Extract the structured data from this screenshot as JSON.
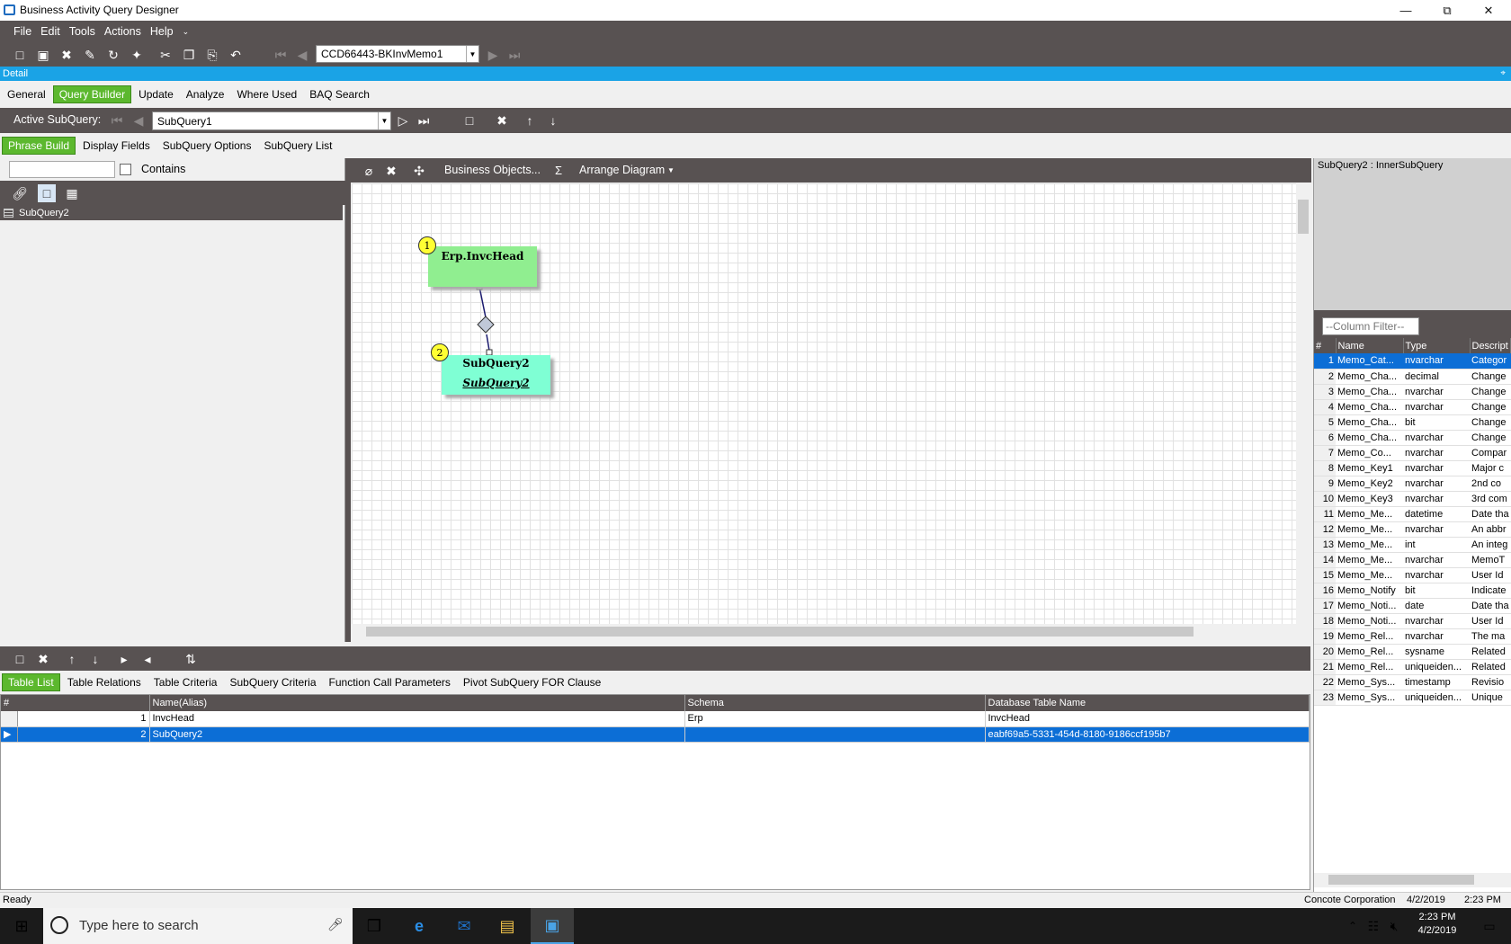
{
  "window": {
    "title": "Business Activity Query Designer",
    "minimize_icon": "minimize-icon",
    "restore_icon": "restore-icon",
    "close_icon": "close-icon"
  },
  "menu": [
    "File",
    "Edit",
    "Tools",
    "Actions",
    "Help"
  ],
  "toolbar": {
    "record_value": "CCD66443-BKInvMemo1",
    "icons": [
      "new-icon",
      "save-icon",
      "delete-icon",
      "edit-icon",
      "refresh-icon",
      "clear-icon",
      "cut-icon",
      "copy-icon",
      "paste-icon",
      "undo-icon",
      "first-icon",
      "prev-icon",
      "next-icon",
      "last-icon"
    ]
  },
  "detail_label": "Detail",
  "main_tabs": [
    "General",
    "Query Builder",
    "Update",
    "Analyze",
    "Where Used",
    "BAQ Search"
  ],
  "subquery_bar": {
    "label": "Active SubQuery:",
    "value": "SubQuery1"
  },
  "sub_tabs": [
    "Phrase Build",
    "Display Fields",
    "SubQuery Options",
    "SubQuery List"
  ],
  "left_panel": {
    "search_value": "",
    "contains_label": "Contains",
    "tree_item": "SubQuery2"
  },
  "diagram_toolbar": {
    "business_objects": "Business Objects...",
    "sigma": "Σ",
    "arrange": "Arrange Diagram"
  },
  "diagram": {
    "nodes": [
      {
        "badge": "1",
        "title": "Erp.InvcHead",
        "subtitle": "",
        "color": "#90ee90"
      },
      {
        "badge": "2",
        "title": "SubQuery2",
        "subtitle": "SubQuery2",
        "color": "#7fffd4"
      }
    ]
  },
  "right_panel": {
    "header": "SubQuery2 : InnerSubQuery",
    "filter_placeholder": "--Column Filter--",
    "columns": [
      "#",
      "Name",
      "Type",
      "Descript"
    ],
    "rows": [
      [
        "1",
        "Memo_Cat...",
        "nvarchar",
        "Categor"
      ],
      [
        "2",
        "Memo_Cha...",
        "decimal",
        "Change"
      ],
      [
        "3",
        "Memo_Cha...",
        "nvarchar",
        "Change"
      ],
      [
        "4",
        "Memo_Cha...",
        "nvarchar",
        "Change"
      ],
      [
        "5",
        "Memo_Cha...",
        "bit",
        "Change"
      ],
      [
        "6",
        "Memo_Cha...",
        "nvarchar",
        "Change"
      ],
      [
        "7",
        "Memo_Co...",
        "nvarchar",
        "Compar"
      ],
      [
        "8",
        "Memo_Key1",
        "nvarchar",
        "Major c"
      ],
      [
        "9",
        "Memo_Key2",
        "nvarchar",
        "2nd co"
      ],
      [
        "10",
        "Memo_Key3",
        "nvarchar",
        "3rd com"
      ],
      [
        "11",
        "Memo_Me...",
        "datetime",
        "Date tha"
      ],
      [
        "12",
        "Memo_Me...",
        "nvarchar",
        "An abbr"
      ],
      [
        "13",
        "Memo_Me...",
        "int",
        "An integ"
      ],
      [
        "14",
        "Memo_Me...",
        "nvarchar",
        "MemoT"
      ],
      [
        "15",
        "Memo_Me...",
        "nvarchar",
        "User Id"
      ],
      [
        "16",
        "Memo_Notify",
        "bit",
        "Indicate"
      ],
      [
        "17",
        "Memo_Noti...",
        "date",
        "Date tha"
      ],
      [
        "18",
        "Memo_Noti...",
        "nvarchar",
        "User Id"
      ],
      [
        "19",
        "Memo_Rel...",
        "nvarchar",
        "The ma"
      ],
      [
        "20",
        "Memo_Rel...",
        "sysname",
        "Related"
      ],
      [
        "21",
        "Memo_Rel...",
        "uniqueiden...",
        "Related"
      ],
      [
        "22",
        "Memo_Sys...",
        "timestamp",
        "Revisio"
      ],
      [
        "23",
        "Memo_Sys...",
        "uniqueiden...",
        "Unique"
      ]
    ]
  },
  "bottom_tabs": [
    "Table List",
    "Table Relations",
    "Table Criteria",
    "SubQuery Criteria",
    "Function Call Parameters",
    "Pivot SubQuery FOR Clause"
  ],
  "table_list": {
    "columns": [
      "#",
      "Name(Alias)",
      "Schema",
      "Database Table Name"
    ],
    "rows": [
      [
        "1",
        "InvcHead",
        "Erp",
        "InvcHead"
      ],
      [
        "2",
        "SubQuery2",
        "",
        "eabf69a5-5331-454d-8180-9186ccf195b7"
      ]
    ]
  },
  "status": {
    "left": "Ready",
    "company": "Concote Corporation",
    "date": "4/2/2019",
    "time": "2:23 PM"
  },
  "taskbar": {
    "search_placeholder": "Type here to search",
    "clock_time": "2:23 PM",
    "clock_date": "4/2/2019"
  }
}
